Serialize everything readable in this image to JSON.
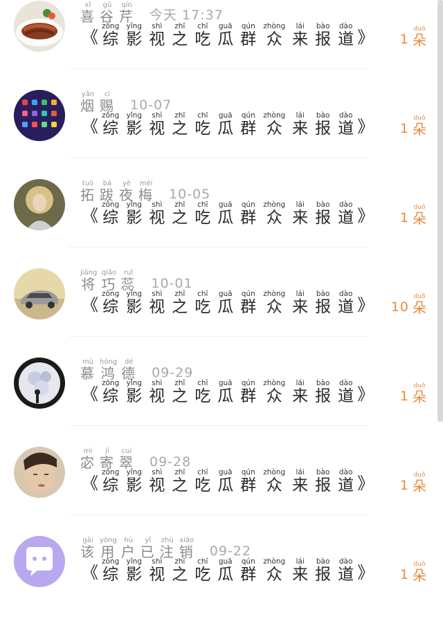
{
  "items": [
    {
      "name": [
        {
          "char": "喜",
          "py": "xǐ"
        },
        {
          "char": "谷",
          "py": "gǔ"
        },
        {
          "char": "芹",
          "py": "qín"
        }
      ],
      "time": "今天 17:37",
      "title": "综影视之吃瓜群众来报道",
      "flowers": "1",
      "avatar": "food-photo-avatar"
    },
    {
      "name": [
        {
          "char": "烟",
          "py": "yān"
        },
        {
          "char": "赐",
          "py": "cì"
        }
      ],
      "time": "10-07",
      "title": "综影视之吃瓜群众来报道",
      "flowers": "1",
      "avatar": "phone-screen-avatar"
    },
    {
      "name": [
        {
          "char": "拓",
          "py": "tuò"
        },
        {
          "char": "跋",
          "py": "bá"
        },
        {
          "char": "夜",
          "py": "yè"
        },
        {
          "char": "梅",
          "py": "méi"
        }
      ],
      "time": "10-05",
      "title": "综影视之吃瓜群众来报道",
      "flowers": "1",
      "avatar": "woman-portrait-avatar"
    },
    {
      "name": [
        {
          "char": "将",
          "py": "jiāng"
        },
        {
          "char": "巧",
          "py": "qiǎo"
        },
        {
          "char": "蕊",
          "py": "ruǐ"
        }
      ],
      "time": "10-01",
      "title": "综影视之吃瓜群众来报道",
      "flowers": "10",
      "avatar": "car-photo-avatar"
    },
    {
      "name": [
        {
          "char": "慕",
          "py": "mù"
        },
        {
          "char": "鸿",
          "py": "hóng"
        },
        {
          "char": "德",
          "py": "dé"
        }
      ],
      "time": "09-29",
      "title": "综影视之吃瓜群众来报道",
      "flowers": "1",
      "avatar": "flower-art-avatar"
    },
    {
      "name": [
        {
          "char": "宓",
          "py": "mì"
        },
        {
          "char": "寄",
          "py": "jì"
        },
        {
          "char": "翠",
          "py": "cuì"
        }
      ],
      "time": "09-28",
      "title": "综影视之吃瓜群众来报道",
      "flowers": "1",
      "avatar": "man-portrait-avatar"
    },
    {
      "name": [
        {
          "char": "该",
          "py": "gāi"
        },
        {
          "char": "用",
          "py": "yòng"
        },
        {
          "char": "户",
          "py": "hù"
        },
        {
          "char": "已",
          "py": "yǐ"
        },
        {
          "char": "注",
          "py": "zhù"
        },
        {
          "char": "销",
          "py": "xiāo"
        }
      ],
      "time": "09-22",
      "title": "综影视之吃瓜群众来报道",
      "flowers": "1",
      "avatar": "deleted-user-avatar"
    }
  ],
  "title_pinyin": [
    "zōng",
    "yǐng",
    "shì",
    "zhī",
    "chī",
    "guā",
    "qún",
    "zhòng",
    "lái",
    "bào",
    "dào"
  ],
  "flower_unit": {
    "char": "朵",
    "py": "duǒ"
  },
  "colors": {
    "accent": "#e88a3c",
    "name": "#8a8a8a",
    "title": "#2a2a2a",
    "time": "#a8a8a8"
  }
}
